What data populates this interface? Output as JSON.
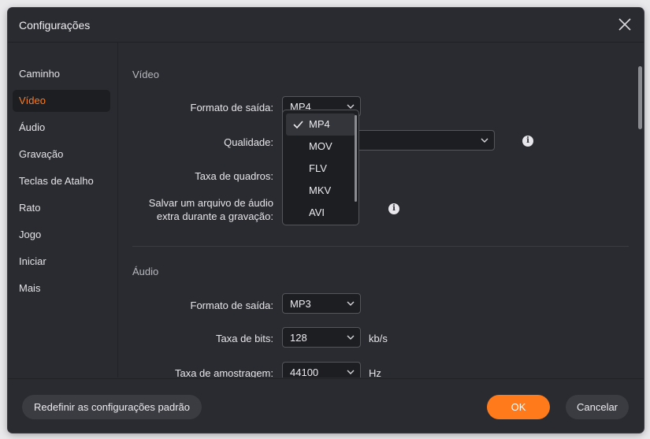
{
  "window": {
    "title": "Configurações"
  },
  "sidebar": {
    "items": [
      {
        "label": "Caminho"
      },
      {
        "label": "Vídeo"
      },
      {
        "label": "Áudio"
      },
      {
        "label": "Gravação"
      },
      {
        "label": "Teclas de Atalho"
      },
      {
        "label": "Rato"
      },
      {
        "label": "Jogo"
      },
      {
        "label": "Iniciar"
      },
      {
        "label": "Mais"
      }
    ],
    "active": "Vídeo"
  },
  "video": {
    "section_title": "Vídeo",
    "output_format_label": "Formato de saída:",
    "output_format_value": "MP4",
    "quality_label": "Qualidade:",
    "quality_value": "",
    "framerate_label": "Taxa de quadros:",
    "save_audio_label_line1": "Salvar um arquivo de áudio",
    "save_audio_label_line2": "extra durante a gravação:",
    "format_options": [
      "MP4",
      "MOV",
      "FLV",
      "MKV",
      "AVI"
    ],
    "selected_format": "MP4"
  },
  "audio": {
    "section_title": "Áudio",
    "output_format_label": "Formato de saída:",
    "output_format_value": "MP3",
    "bitrate_label": "Taxa de bits:",
    "bitrate_value": "128",
    "bitrate_unit": "kb/s",
    "samplerate_label": "Taxa de amostragem:",
    "samplerate_value": "44100",
    "samplerate_unit": "Hz"
  },
  "footer": {
    "reset_label": "Redefinir as configurações padrão",
    "ok_label": "OK",
    "cancel_label": "Cancelar"
  },
  "colors": {
    "accent": "#ff7a1a",
    "background": "#2a2b30",
    "field": "#1d1e22"
  }
}
